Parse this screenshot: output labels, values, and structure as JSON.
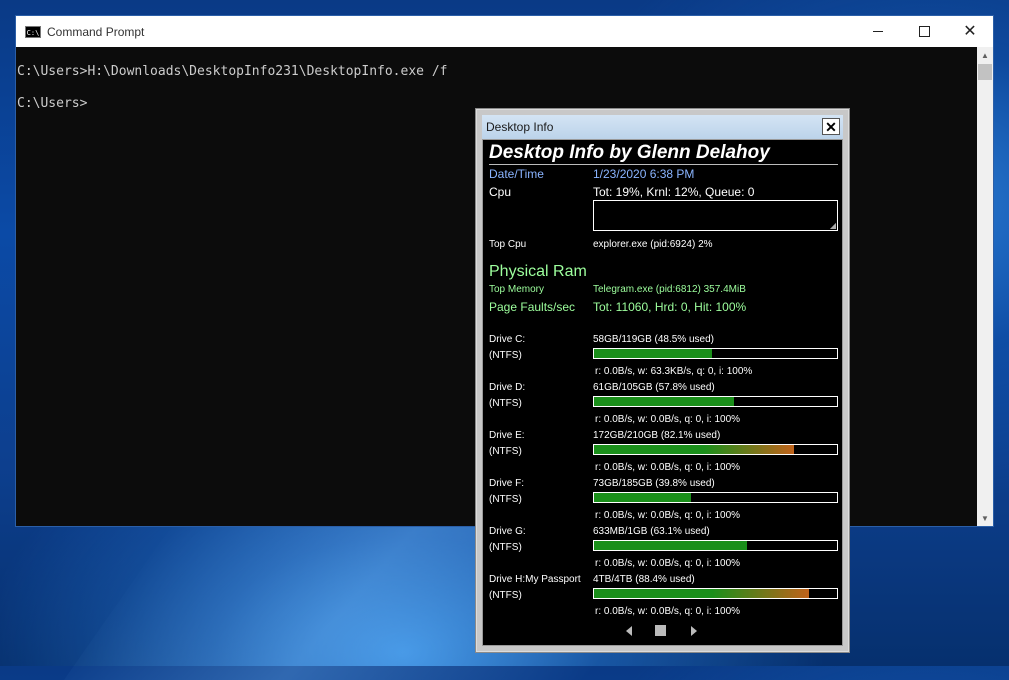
{
  "cmd": {
    "title": "Command Prompt",
    "lines": [
      "C:\\Users>H:\\Downloads\\DesktopInfo231\\DesktopInfo.exe /f",
      "C:\\Users>"
    ]
  },
  "desktop_info": {
    "window_title": "Desktop Info",
    "close_label": "✕",
    "heading": "Desktop Info by Glenn Delahoy",
    "datetime": {
      "label": "Date/Time",
      "value": "1/23/2020 6:38 PM"
    },
    "cpu": {
      "label": "Cpu",
      "value": "Tot: 19%, Krnl: 12%, Queue: 0"
    },
    "top_cpu": {
      "label": "Top Cpu",
      "value": "explorer.exe (pid:6924) 2%"
    },
    "physical_ram": {
      "label": "Physical Ram"
    },
    "top_memory": {
      "label": "Top Memory",
      "value": "Telegram.exe (pid:6812) 357.4MiB"
    },
    "page_faults": {
      "label": "Page Faults/sec",
      "value": "Tot: 11060, Hrd: 0, Hit: 100%"
    },
    "drives": [
      {
        "label": "Drive C:",
        "fs": "(NTFS)",
        "usage": "58GB/119GB (48.5% used)",
        "used_fraction": 0.485,
        "io": "r: 0.0B/s, w: 63.3KB/s, q: 0, i: 100%"
      },
      {
        "label": "Drive D:",
        "fs": "(NTFS)",
        "usage": "61GB/105GB (57.8% used)",
        "used_fraction": 0.578,
        "io": "r: 0.0B/s, w: 0.0B/s, q: 0, i: 100%"
      },
      {
        "label": "Drive E:",
        "fs": "(NTFS)",
        "usage": "172GB/210GB (82.1% used)",
        "used_fraction": 0.821,
        "io": "r: 0.0B/s, w: 0.0B/s, q: 0, i: 100%"
      },
      {
        "label": "Drive F:",
        "fs": "(NTFS)",
        "usage": "73GB/185GB (39.8% used)",
        "used_fraction": 0.398,
        "io": "r: 0.0B/s, w: 0.0B/s, q: 0, i: 100%"
      },
      {
        "label": "Drive G:",
        "fs": "(NTFS)",
        "usage": "633MB/1GB (63.1% used)",
        "used_fraction": 0.631,
        "io": "r: 0.0B/s, w: 0.0B/s, q: 0, i: 100%"
      },
      {
        "label": "Drive H:My Passport",
        "fs": "(NTFS)",
        "usage": "4TB/4TB (88.4% used)",
        "used_fraction": 0.884,
        "io": "r: 0.0B/s, w: 0.0B/s, q: 0, i: 100%"
      }
    ]
  },
  "colors": {
    "bar_green": "#1a8f1a",
    "bar_warn_gradient_end": "#c0621a",
    "label_blue": "#8ab4ff",
    "label_green": "#9dff9d"
  }
}
